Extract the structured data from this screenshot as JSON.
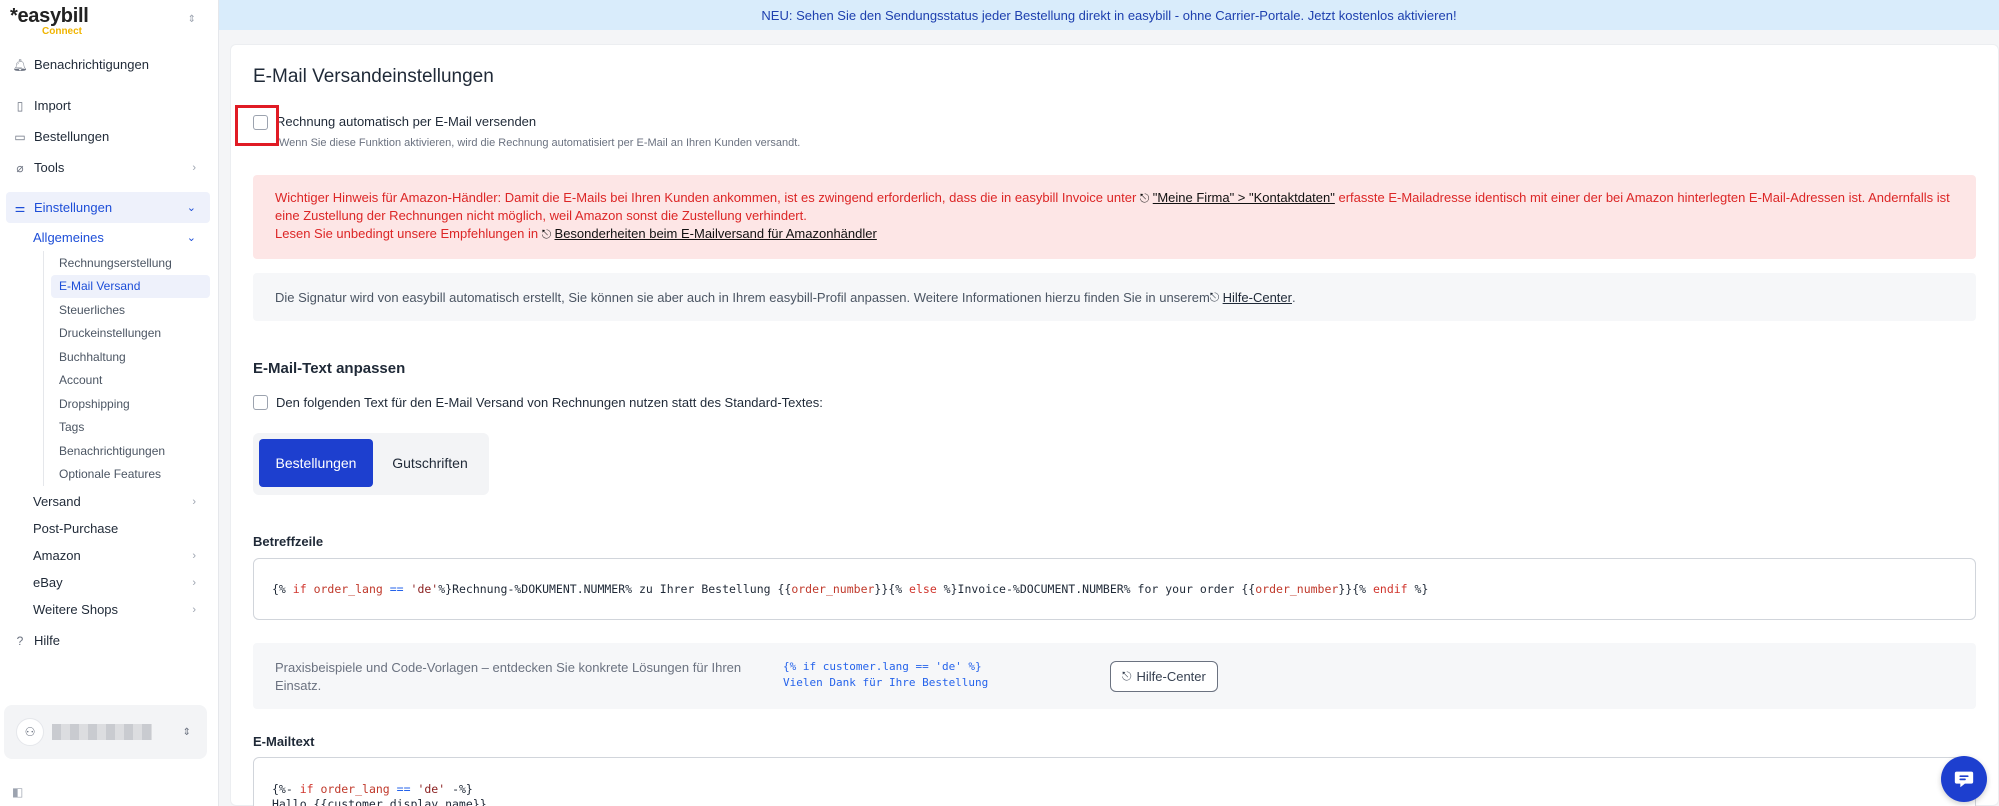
{
  "sidebar": {
    "logo_main": "*easybill",
    "logo_sub": "Connect",
    "nav": {
      "notifications": "Benachrichtigungen",
      "import": "Import",
      "orders": "Bestellungen",
      "tools": "Tools",
      "settings": "Einstellungen"
    },
    "settings_sub": {
      "general": "Allgemeines",
      "items": [
        "Rechnungserstellung",
        "E-Mail Versand",
        "Steuerliches",
        "Druckeinstellungen",
        "Buchhaltung",
        "Account",
        "Dropshipping",
        "Tags",
        "Benachrichtigungen",
        "Optionale Features"
      ],
      "shipping": "Versand",
      "post_purchase": "Post-Purchase",
      "amazon": "Amazon",
      "ebay": "eBay",
      "more_shops": "Weitere Shops"
    },
    "help": "Hilfe"
  },
  "banner": {
    "text": "NEU: Sehen Sie den Sendungsstatus jeder Bestellung direkt in easybill - ohne Carrier-Portale. Jetzt kostenlos aktivieren!"
  },
  "main": {
    "title": "E-Mail Versandeinstellungen",
    "auto_send_label": "Rechnung automatisch per E-Mail versenden",
    "auto_send_help": "Wenn Sie diese Funktion aktivieren, wird die Rechnung automatisiert per E-Mail an Ihren Kunden versandt.",
    "alert": {
      "text1": "Wichtiger Hinweis für Amazon-Händler: Damit die E-Mails bei Ihren Kunden ankommen, ist es zwingend erforderlich, dass die in easybill Invoice unter ",
      "link1": "\"Meine Firma\" > \"Kontaktdaten\"",
      "text2": " erfasste E-Mailadresse identisch mit einer der bei Amazon hinterlegten E-Mail-Adressen ist. Andernfalls ist eine Zustellung der Rechnungen nicht möglich, weil Amazon sonst die Zustellung verhindert.",
      "text3": "Lesen Sie unbedingt unsere Empfehlungen in ",
      "link2": "Besonderheiten beim E-Mailversand für Amazonhändler"
    },
    "info": {
      "text": "Die Signatur wird von easybill automatisch erstellt, Sie können sie aber auch in Ihrem easybill-Profil anpassen. Weitere Informationen hierzu finden Sie in unserem ",
      "link": "Hilfe-Center",
      "end": "."
    },
    "text_section_title": "E-Mail-Text anpassen",
    "custom_text_label": "Den folgenden Text für den E-Mail Versand von Rechnungen nutzen statt des Standard-Textes:",
    "tabs": [
      "Bestellungen",
      "Gutschriften"
    ],
    "subject_label": "Betreffzeile",
    "subject": {
      "p1": "{% ",
      "if1": "if",
      "v1": " order_lang ",
      "eq": "==",
      "s1": " 'de'",
      "p2": "%}Rechnung-%DOKUMENT.NUMMER% zu Ihrer Bestellung {{",
      "v2": "order_number",
      "p3": "}}{% ",
      "else": "else",
      "p4": " %}Invoice-%DOCUMENT.NUMBER% for your order {{",
      "v3": "order_number",
      "p5": "}}{% ",
      "endif": "endif",
      "p6": " %}"
    },
    "tip": {
      "text": "Praxisbeispiele und Code-Vorlagen – entdecken Sie konkrete Lösungen für Ihren Einsatz.",
      "code": "{% if customer.lang == 'de' %}\nVielen Dank für Ihre Bestellung",
      "button": "Hilfe-Center"
    },
    "mailtext_label": "E-Mailtext",
    "mailtext": {
      "l1a": "{%- ",
      "l1if": "if",
      "l1v": " order_lang ",
      "l1eq": "==",
      "l1s": " 'de'",
      "l1b": " -%}",
      "l2": "Hallo {{customer.display_name}},"
    }
  },
  "colors": {
    "primary": "#1d3fcf",
    "alert_bg": "#fde6e6",
    "alert_text": "#dc2626",
    "banner_bg": "#d9ecfb",
    "highlight": "#e01b24"
  }
}
